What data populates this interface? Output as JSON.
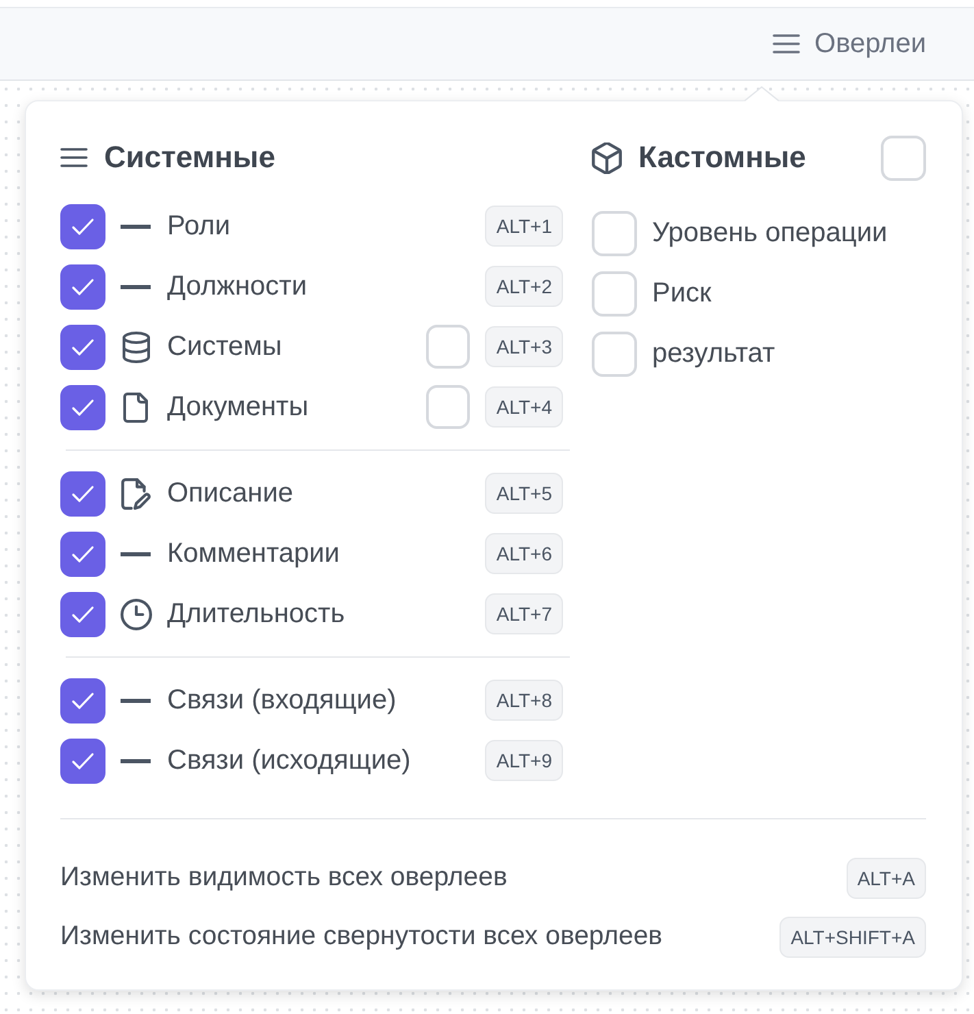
{
  "toolbar": {
    "overlays_button": {
      "label": "Оверлеи"
    }
  },
  "overlays_popover": {
    "system": {
      "title": "Системные",
      "groups": [
        {
          "items": [
            {
              "kind": "line",
              "label": "Роли",
              "checked": true,
              "shortcut": "ALT+1"
            },
            {
              "kind": "line",
              "label": "Должности",
              "checked": true,
              "shortcut": "ALT+2"
            },
            {
              "kind": "database",
              "label": "Системы",
              "checked": true,
              "collapsed": false,
              "shortcut": "ALT+3"
            },
            {
              "kind": "file",
              "label": "Документы",
              "checked": true,
              "collapsed": false,
              "shortcut": "ALT+4"
            }
          ]
        },
        {
          "items": [
            {
              "kind": "edit",
              "label": "Описание",
              "checked": true,
              "shortcut": "ALT+5"
            },
            {
              "kind": "line",
              "label": "Комментарии",
              "checked": true,
              "shortcut": "ALT+6"
            },
            {
              "kind": "clock",
              "label": "Длительность",
              "checked": true,
              "shortcut": "ALT+7"
            }
          ]
        },
        {
          "items": [
            {
              "kind": "line",
              "label": "Связи (входящие)",
              "checked": true,
              "shortcut": "ALT+8"
            },
            {
              "kind": "line",
              "label": "Связи (исходящие)",
              "checked": true,
              "shortcut": "ALT+9"
            }
          ]
        }
      ]
    },
    "custom": {
      "title": "Кастомные",
      "checked": false,
      "items": [
        {
          "label": "Уровень операции",
          "checked": false
        },
        {
          "label": "Риск",
          "checked": false
        },
        {
          "label": "результат",
          "checked": false
        }
      ]
    },
    "actions": [
      {
        "label": "Изменить видимость всех оверлеев",
        "shortcut": "ALT+A"
      },
      {
        "label": "Изменить состояние свернутости всех оверлеев",
        "shortcut": "ALT+SHIFT+A"
      }
    ]
  }
}
